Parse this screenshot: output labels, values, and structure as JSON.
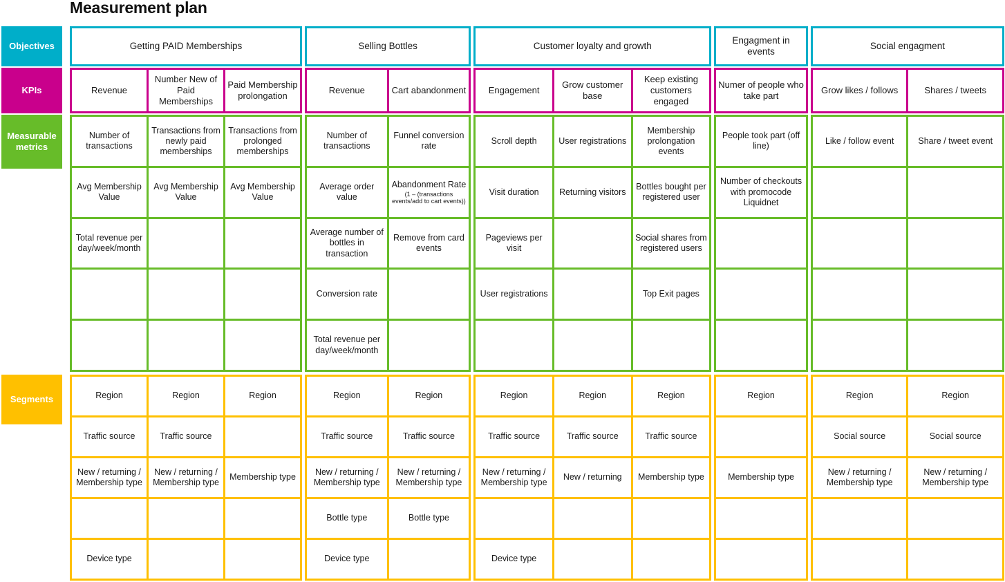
{
  "title": "Measurement plan",
  "colors": {
    "objectives": "#00AEC9",
    "kpis": "#C9008C",
    "metrics": "#67BC29",
    "segments": "#FFC000",
    "cell_background": "#FFFFFF",
    "text": "#1A1A1A"
  },
  "row_labels": {
    "objectives": "Objectives",
    "kpis": "KPIs",
    "metrics": "Measurable metrics",
    "segments": "Segments"
  },
  "groups": [
    {
      "objective": "Getting PAID Memberships",
      "kpis": [
        "Revenue",
        "Number New of Paid Memberships",
        "Paid Membership prolongation"
      ],
      "metrics": [
        [
          "Number of transactions",
          "Transactions from newly paid memberships",
          "Transactions from prolonged memberships"
        ],
        [
          "Avg Membership Value",
          "Avg Membership Value",
          "Avg Membership Value"
        ],
        [
          "Total revenue per day/week/month",
          "",
          ""
        ],
        [
          "",
          "",
          ""
        ],
        [
          "",
          "",
          ""
        ]
      ],
      "segments": [
        [
          "Region",
          "Region",
          "Region"
        ],
        [
          "Traffic source",
          "Traffic source",
          ""
        ],
        [
          "New / returning / Membership type",
          "New / returning / Membership type",
          "Membership type"
        ],
        [
          "",
          "",
          ""
        ],
        [
          "Device type",
          "",
          ""
        ]
      ]
    },
    {
      "objective": "Selling Bottles",
      "kpis": [
        "Revenue",
        "Cart abandonment"
      ],
      "metrics": [
        [
          "Number of transactions",
          "Funnel conversion rate"
        ],
        [
          "Average order value",
          {
            "main": "Abandonment Rate",
            "note": "(1 – (transactions events/add to cart events))"
          }
        ],
        [
          "Average number of bottles in transaction",
          "Remove from card events"
        ],
        [
          "Conversion rate",
          ""
        ],
        [
          "Total revenue per day/week/month",
          ""
        ]
      ],
      "segments": [
        [
          "Region",
          "Region"
        ],
        [
          "Traffic source",
          "Traffic source"
        ],
        [
          "New / returning / Membership type",
          "New / returning / Membership type"
        ],
        [
          "Bottle type",
          "Bottle type"
        ],
        [
          "Device type",
          ""
        ]
      ]
    },
    {
      "objective": "Customer loyalty and growth",
      "kpis": [
        "Engagement",
        "Grow customer base",
        "Keep existing customers engaged"
      ],
      "metrics": [
        [
          "Scroll depth",
          "User registrations",
          "Membership prolongation events"
        ],
        [
          "Visit duration",
          "Returning visitors",
          "Bottles bought per registered user"
        ],
        [
          "Pageviews per visit",
          "",
          "Social shares from registered users"
        ],
        [
          "User registrations",
          "",
          "Top Exit pages"
        ],
        [
          "",
          "",
          ""
        ]
      ],
      "segments": [
        [
          "Region",
          "Region",
          "Region"
        ],
        [
          "Traffic source",
          "Traffic source",
          "Traffic source"
        ],
        [
          "New / returning / Membership type",
          "New / returning",
          "Membership type"
        ],
        [
          "",
          "",
          ""
        ],
        [
          "Device type",
          "",
          ""
        ]
      ]
    },
    {
      "objective": "Engagment in events",
      "kpis": [
        "Numer of people who take part"
      ],
      "metrics": [
        [
          "People took part (off line)"
        ],
        [
          "Number of checkouts with promocode Liquidnet"
        ],
        [
          ""
        ],
        [
          ""
        ],
        [
          ""
        ]
      ],
      "segments": [
        [
          "Region"
        ],
        [
          ""
        ],
        [
          "Membership type"
        ],
        [
          ""
        ],
        [
          ""
        ]
      ]
    },
    {
      "objective": "Social engagment",
      "kpis": [
        "Grow likes / follows",
        "Shares / tweets"
      ],
      "metrics": [
        [
          "Like / follow event",
          "Share / tweet event"
        ],
        [
          "",
          ""
        ],
        [
          "",
          ""
        ],
        [
          "",
          ""
        ],
        [
          "",
          ""
        ]
      ],
      "segments": [
        [
          "Region",
          "Region"
        ],
        [
          "Social source",
          "Social source"
        ],
        [
          "New / returning / Membership type",
          "New / returning / Membership type"
        ],
        [
          "",
          ""
        ],
        [
          "",
          ""
        ]
      ]
    }
  ]
}
